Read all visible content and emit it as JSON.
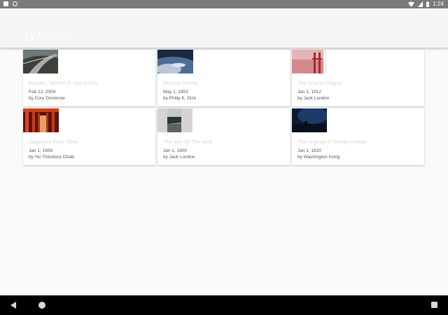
{
  "status_bar": {
    "time": "1:24",
    "icons": [
      "notification-icon",
      "sync-icon",
      "wifi-icon",
      "cell-signal-icon",
      "battery-icon"
    ]
  },
  "app_bar": {
    "logo_bold": "xyz",
    "logo_light": "reader"
  },
  "books": [
    {
      "title": "Ebooks, Neither E, Nor Books",
      "date": "Feb 12, 2004",
      "author": "by Cory Doctorow",
      "thumb": "road-photo"
    },
    {
      "title": "Second Variety",
      "date": "May 1, 1953",
      "author": "by Philip K. Dick",
      "thumb": "earth-photo"
    },
    {
      "title": "The Scarlet Plague",
      "date": "Jan 1, 1912",
      "author": "by Jack London",
      "thumb": "bridge-fog-photo"
    },
    {
      "title": "Japanese Fairy Tales",
      "date": "Jan 1, 1908",
      "author": "by Yei Theodora Ozaki",
      "thumb": "torii-gates-photo"
    },
    {
      "title": "The Son Of The Wolf",
      "date": "Jan 1, 1900",
      "author": "by Jack London",
      "thumb": "lake-photo"
    },
    {
      "title": "The Legend of Sleepy Hollow",
      "date": "Jan 1, 1820",
      "author": "by Washington Irving",
      "thumb": "night-sky-photo"
    }
  ],
  "nav_bar": {
    "icons": [
      "back-icon",
      "home-icon",
      "recents-icon"
    ]
  }
}
